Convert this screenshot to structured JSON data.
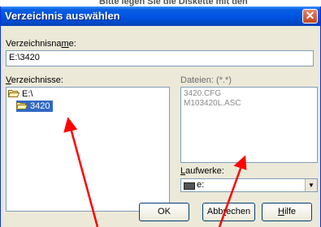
{
  "background": {
    "behind_text": "Bitte legen Sie die Diskette mit den"
  },
  "dialog": {
    "title": "Verzeichnis auswählen",
    "close_glyph": "✕",
    "dirname_label_pre": "Verzeichnisna",
    "dirname_label_u": "m",
    "dirname_label_post": "e:",
    "dirname_value": "E:\\3420",
    "dirs_label_pre": "",
    "dirs_label_u": "V",
    "dirs_label_post": "erzeichnisse:",
    "dirs": [
      {
        "label": "E:\\",
        "selected": false
      },
      {
        "label": "3420",
        "selected": true
      }
    ],
    "files_label": "Dateien: (*.*)",
    "files": [
      "3420.CFG",
      "M103420L.ASC"
    ],
    "drives_label_pre": "",
    "drives_label_u": "L",
    "drives_label_post": "aufwerke:",
    "drive_value": "e:",
    "buttons": {
      "ok": "OK",
      "cancel_pre": "Abb",
      "cancel_u": "r",
      "cancel_post": "echen",
      "help_pre": "",
      "help_u": "H",
      "help_post": "ilfe"
    }
  },
  "colors": {
    "titlebar": "#0054e3",
    "selection": "#316ac5",
    "annotation_arrow": "#ff0000"
  }
}
